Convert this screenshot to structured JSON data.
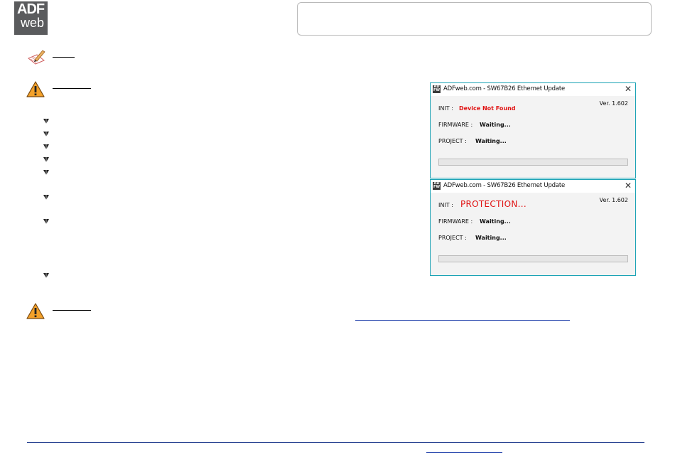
{
  "logo": {
    "line1": "ADF",
    "line2": "web"
  },
  "dialogs": [
    {
      "title": "ADFweb.com - SW67B26 Ethernet Update",
      "close_glyph": "✕",
      "version": "Ver. 1.602",
      "init_label": "INIT :",
      "init_value": "Device Not Found",
      "firmware_label": "FIRMWARE :",
      "firmware_value": "Waiting...",
      "project_label": "PROJECT :",
      "project_value": "Waiting...",
      "progress": 0
    },
    {
      "title": "ADFweb.com - SW67B26 Ethernet Update",
      "close_glyph": "✕",
      "version": "Ver. 1.602",
      "init_label": "INIT :",
      "init_value": "PROTECTION...",
      "firmware_label": "FIRMWARE :",
      "firmware_value": "Waiting...",
      "project_label": "PROJECT :",
      "project_value": "Waiting...",
      "progress": 0
    }
  ],
  "icons": {
    "note": "pencil-note-icon",
    "warning": "warning-triangle-icon",
    "bullet": "bullet-arrow-icon"
  },
  "colors": {
    "dialog_border": "#1ba3b5",
    "error_text": "#e01010",
    "link": "#2f4cb0",
    "footer_rule": "#1f3b8c"
  }
}
